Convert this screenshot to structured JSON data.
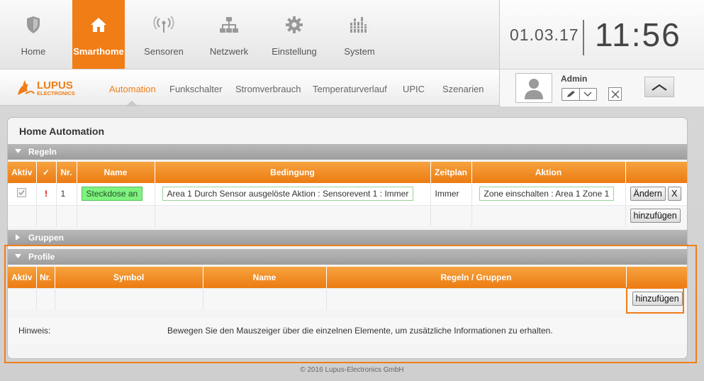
{
  "nav": {
    "items": [
      {
        "label": "Home",
        "icon": "shield-icon"
      },
      {
        "label": "Smarthome",
        "icon": "house-icon"
      },
      {
        "label": "Sensoren",
        "icon": "antenna-icon"
      },
      {
        "label": "Netzwerk",
        "icon": "network-icon"
      },
      {
        "label": "Einstellung",
        "icon": "gear-icon"
      },
      {
        "label": "System",
        "icon": "equalizer-icon"
      }
    ],
    "active": "Smarthome"
  },
  "clock": {
    "date": "01.03.17",
    "time": "11:56"
  },
  "brand": {
    "logo_text": "LUPUS",
    "logo_sub": "ELECTRONICS",
    "accent": "#f07d16"
  },
  "subnav": {
    "items": [
      "Automation",
      "Funkschalter",
      "Stromverbrauch",
      "Temperaturverlauf",
      "UPIC",
      "Szenarien"
    ],
    "active": "Automation"
  },
  "user": {
    "name": "Admin"
  },
  "panel": {
    "title": "Home Automation",
    "rules": {
      "title": "Regeln",
      "headers": [
        "Aktiv",
        "✓",
        "Nr.",
        "Name",
        "Bedingung",
        "Zeitplan",
        "Aktion",
        ""
      ],
      "rows": [
        {
          "active": true,
          "flag": "!",
          "nr": "1",
          "name": "Steckdose an",
          "condition": "Area 1 Durch Sensor ausgelöste Aktion : Sensorevent 1 : Immer",
          "schedule": "Immer",
          "action": "Zone einschalten : Area 1 Zone 1",
          "edit_label": "Ändern",
          "delete_label": "X"
        }
      ],
      "add_label": "hinzufügen"
    },
    "groups": {
      "title": "Gruppen"
    },
    "profiles": {
      "title": "Profile",
      "headers": [
        "Aktiv",
        "Nr.",
        "Symbol",
        "Name",
        "Regeln / Gruppen",
        ""
      ],
      "add_label": "hinzufügen"
    },
    "hint": {
      "label": "Hinweis:",
      "text": "Bewegen Sie den Mauszeiger über die einzelnen Elemente, um zusätzliche Informationen zu erhalten."
    }
  },
  "footer": {
    "text": "© 2016 Lupus-Electronics GmbH"
  }
}
